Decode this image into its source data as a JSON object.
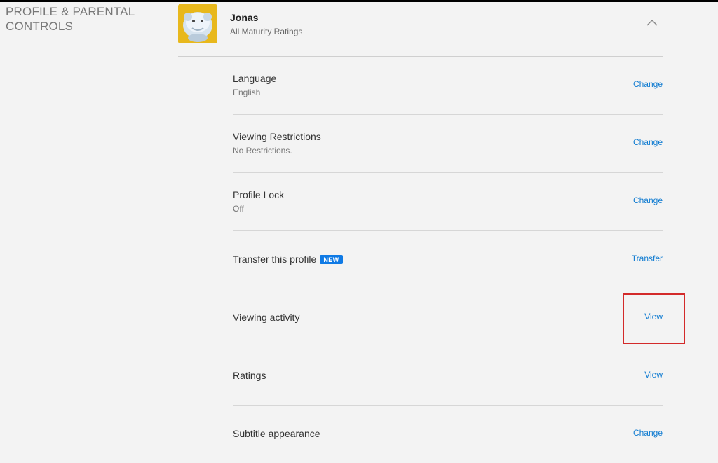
{
  "section": {
    "title": "PROFILE & PARENTAL\nCONTROLS"
  },
  "profile": {
    "name": "Jonas",
    "maturity": "All Maturity Ratings",
    "avatar_icon": "snowball-monster-avatar",
    "collapse_icon": "chevron-up-icon"
  },
  "rows": [
    {
      "label": "Language",
      "value": "English",
      "action": "Change"
    },
    {
      "label": "Viewing Restrictions",
      "value": "No Restrictions.",
      "action": "Change"
    },
    {
      "label": "Profile Lock",
      "value": "Off",
      "action": "Change"
    },
    {
      "label": "Transfer this profile",
      "badge": "NEW",
      "action": "Transfer"
    },
    {
      "label": "Viewing activity",
      "action": "View"
    },
    {
      "label": "Ratings",
      "action": "View"
    },
    {
      "label": "Subtitle appearance",
      "action": "Change"
    }
  ],
  "colors": {
    "link": "#0f7bd1",
    "badge": "#0f7ae5",
    "highlight": "#d32a2a"
  }
}
